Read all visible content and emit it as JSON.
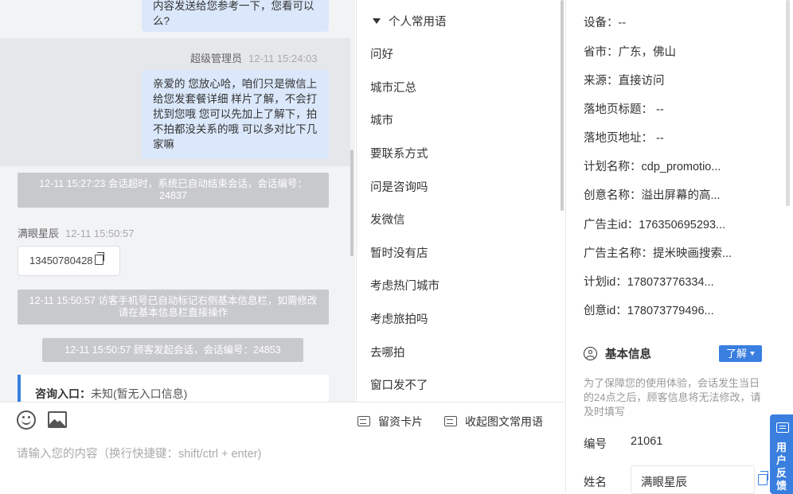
{
  "chat": {
    "msg1_text": "内容发送给您参考一下，您看可以么?",
    "msg2_sender": "超级管理员",
    "msg2_time": "12-11 15:24:03",
    "msg2_text": "亲爱的 您放心哈，咱们只是微信上给您发套餐详细 样片了解，不会打扰到您哦 您可以先加上了解下，拍不拍都没关系的哦 可以多对比下几家嘛",
    "sys1": "12-11 15:27:23 会话超时，系统已自动结束会话，会话编号：24837",
    "msg3_sender": "满眼星辰",
    "msg3_time": "12-11 15:50:57",
    "msg3_phone": "13450780428",
    "sys2": "12-11 15:50:57 访客手机号已自动标记右侧基本信息栏，如需修改请在基本信息栏直接操作",
    "sys3": "12-11 15:50:57 顾客发起会话，会话编号：24853",
    "entry_label": "咨询入口：",
    "entry_value": "未知(暂无入口信息)"
  },
  "input": {
    "leave_card": "留资卡片",
    "collapse_phrases": "收起图文常用语",
    "placeholder": "请输入您的内容（换行快捷键：shift/ctrl + enter)"
  },
  "phrases": {
    "header": "个人常用语",
    "items": [
      "问好",
      "城市汇总",
      "城市",
      "要联系方式",
      "问是咨询吗",
      "发微信",
      "暂时没有店",
      "考虑热门城市",
      "考虑旅拍吗",
      "去哪拍",
      "窗口发不了"
    ]
  },
  "info": {
    "rows": [
      "设备：--",
      "省市：广东，佛山",
      "来源：直接访问",
      "落地页标题： --",
      "落地页地址： --",
      "计划名称：cdp_promotio...",
      "创意名称：溢出屏幕的高...",
      "广告主id：176350695293...",
      "广告主名称：提米映画搜索...",
      "计划id：178073776334...",
      "创意id：178073779496..."
    ],
    "section_title": "基本信息",
    "learn_more": "了解",
    "notice": "为了保障您的使用体验，会话发生当日的24点之后，顾客信息将无法修改，请及时填写",
    "id_label": "编号",
    "id_value": "21061",
    "name_label": "姓名",
    "name_value": "满眼星辰"
  },
  "feedback": {
    "label": "用户反馈"
  },
  "colors": {
    "accent": "#3a7fe0",
    "bubble": "#dbe8fb",
    "system": "#c8c9cc"
  }
}
